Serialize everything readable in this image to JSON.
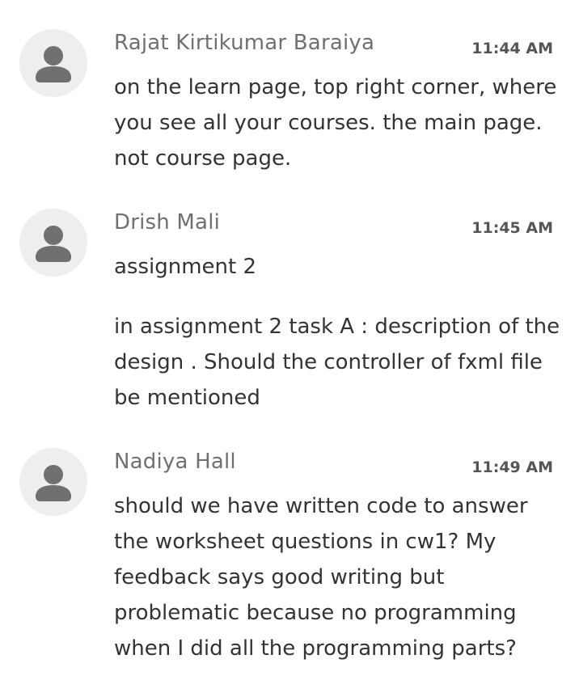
{
  "messages": [
    {
      "author": "Rajat Kirtikumar Baraiya",
      "time": "11:44 AM",
      "paragraphs": [
        "on the learn page, top right corner, where you see all your courses. the main page. not course page."
      ]
    },
    {
      "author": "Drish Mali",
      "time": "11:45 AM",
      "paragraphs": [
        "assignment 2",
        "in assignment 2 task A : description of the design . Should the controller of fxml  file be mentioned"
      ]
    },
    {
      "author": "Nadiya Hall",
      "time": "11:49 AM",
      "paragraphs": [
        "should we have written code to answer the worksheet questions in cw1? My feedback says good writing but problematic because no programming when I did all the programming parts?"
      ]
    }
  ],
  "icons": {
    "avatar": "user-avatar-icon"
  },
  "colors": {
    "avatar_bg": "#eeeeee",
    "avatar_fg": "#707070",
    "author": "#707070",
    "time": "#555555",
    "body": "#333333"
  }
}
